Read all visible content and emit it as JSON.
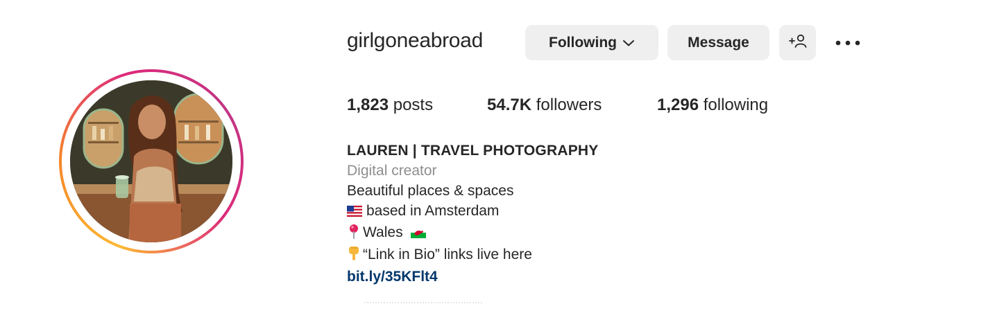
{
  "profile": {
    "username": "girlgoneabroad",
    "avatar_icon": "profile-photo"
  },
  "actions": {
    "following_label": "Following",
    "message_label": "Message",
    "add_user_icon": "add-user-icon",
    "more_icon": "more-options-icon"
  },
  "stats": {
    "posts_count": "1,823",
    "posts_label": "posts",
    "followers_count": "54.7K",
    "followers_label": "followers",
    "following_count": "1,296",
    "following_label": "following"
  },
  "bio": {
    "name": "LAUREN | TRAVEL PHOTOGRAPHY",
    "category": "Digital creator",
    "line1": "Beautiful places & spaces",
    "line2": "based in Amsterdam",
    "line3": "Wales",
    "line4": "“Link in Bio” links live here",
    "link": "bit.ly/35KFlt4"
  },
  "colors": {
    "button_bg": "#efefef",
    "text": "#262626",
    "secondary_text": "#8e8e8e",
    "link": "#00376b",
    "ring_start": "#fdb933",
    "ring_end": "#c13584"
  }
}
